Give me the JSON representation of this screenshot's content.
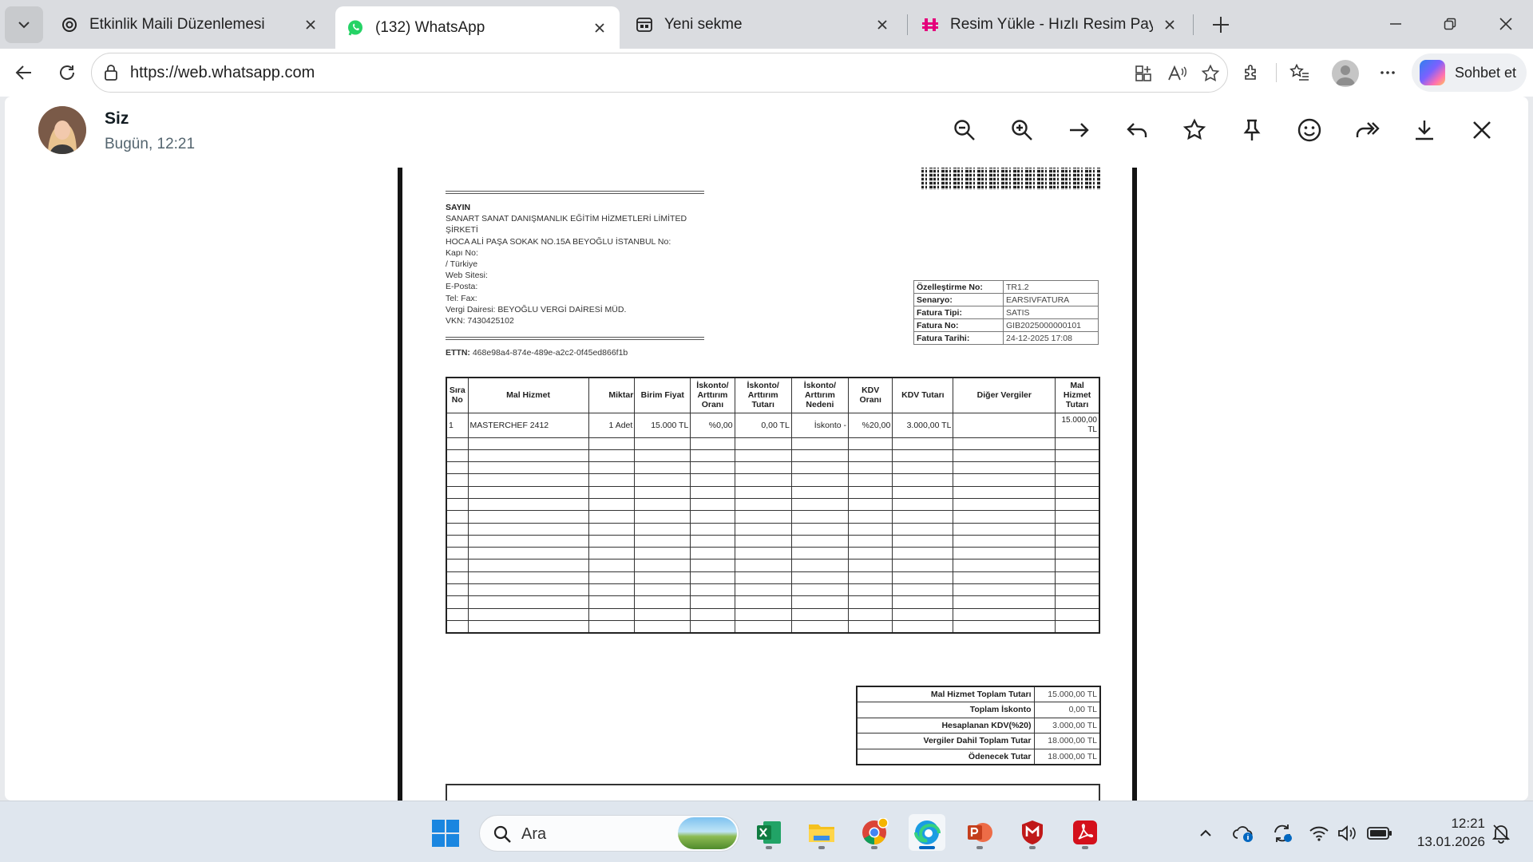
{
  "tabs": [
    {
      "title": "Etkinlik Maili Düzenlemesi",
      "icon": "chatgpt-icon",
      "active": false
    },
    {
      "title": "(132) WhatsApp",
      "icon": "whatsapp-icon",
      "active": true
    },
    {
      "title": "Yeni sekme",
      "icon": "new-tab-page-icon",
      "active": false
    },
    {
      "title": "Resim Yükle - Hızlı Resim Paylaş - İ",
      "icon": "resim-yukle-icon",
      "active": false
    }
  ],
  "address_bar": {
    "url": "https://web.whatsapp.com"
  },
  "copilot": {
    "label": "Sohbet et"
  },
  "viewer": {
    "sender": "Siz",
    "timestamp": "Bugün, 12:21"
  },
  "invoice": {
    "buyer": {
      "heading": "SAYIN",
      "company": "SANART SANAT DANIŞMANLIK EĞİTİM HİZMETLERİ LİMİTED",
      "company2": "ŞİRKETİ",
      "address": "HOCA ALİ PAŞA SOKAK NO.15A BEYOĞLU İSTANBUL  No:",
      "door": "Kapı No:",
      "country": " /  Türkiye",
      "web": "Web Sitesi:",
      "email": "E-Posta:",
      "tel": "Tel: Fax:",
      "tax_office": "Vergi Dairesi: BEYOĞLU VERGİ DAİRESİ MÜD.",
      "vkn": "VKN: 7430425102"
    },
    "ettn_label": "ETTN:",
    "ettn": "468e98a4-874e-489e-a2c2-0f45ed866f1b",
    "meta": [
      {
        "k": "Özelleştirme No:",
        "v": "TR1.2"
      },
      {
        "k": "Senaryo:",
        "v": "EARSIVFATURA"
      },
      {
        "k": "Fatura Tipi:",
        "v": "SATIS"
      },
      {
        "k": "Fatura No:",
        "v": "GIB2025000000101"
      },
      {
        "k": "Fatura Tarihi:",
        "v": "24-12-2025 17:08"
      }
    ],
    "columns": [
      "Sıra No",
      "Mal Hizmet",
      "Miktar",
      "Birim Fiyat",
      "İskonto/ Arttırım Oranı",
      "İskonto/ Arttırım Tutarı",
      "İskonto/ Arttırım Nedeni",
      "KDV Oranı",
      "KDV Tutarı",
      "Diğer Vergiler",
      "Mal Hizmet Tutarı"
    ],
    "rows": [
      [
        "1",
        "MASTERCHEF 2412",
        "1 Adet",
        "15.000 TL",
        "%0,00",
        "0,00 TL",
        "İskonto -",
        "%20,00",
        "3.000,00 TL",
        "",
        "15.000,00 TL"
      ]
    ],
    "totals": [
      {
        "k": "Mal Hizmet Toplam Tutarı",
        "v": "15.000,00 TL"
      },
      {
        "k": "Toplam İskonto",
        "v": "0,00 TL"
      },
      {
        "k": "Hesaplanan KDV(%20)",
        "v": "3.000,00 TL"
      },
      {
        "k": "Vergiler Dahil Toplam Tutar",
        "v": "18.000,00 TL"
      },
      {
        "k": "Ödenecek Tutar",
        "v": "18.000,00 TL"
      }
    ]
  },
  "taskbar": {
    "search_label": "Ara",
    "time": "12:21",
    "date": "13.01.2026"
  }
}
